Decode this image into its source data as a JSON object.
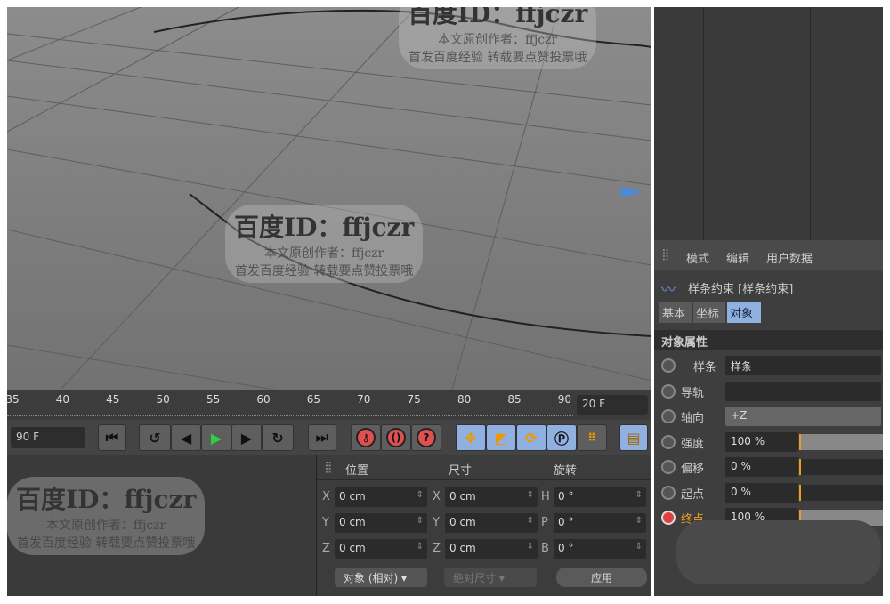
{
  "timeline": {
    "ticks": [
      "35",
      "40",
      "45",
      "50",
      "55",
      "60",
      "65",
      "70",
      "75",
      "80",
      "85",
      "90"
    ],
    "current_frame": "20 F"
  },
  "transport": {
    "end_frame": "90 F"
  },
  "coords": {
    "headers": [
      "位置",
      "尺寸",
      "旋转"
    ],
    "pos": [
      [
        "X",
        "0 cm"
      ],
      [
        "Y",
        "0 cm"
      ],
      [
        "Z",
        "0 cm"
      ]
    ],
    "size": [
      [
        "X",
        "0 cm"
      ],
      [
        "Y",
        "0 cm"
      ],
      [
        "Z",
        "0 cm"
      ]
    ],
    "rot": [
      [
        "H",
        "0 °"
      ],
      [
        "P",
        "0 °"
      ],
      [
        "B",
        "0 °"
      ]
    ],
    "mode_dropdown": "对象 (相对)",
    "size_dropdown": "绝对尺寸",
    "apply": "应用"
  },
  "attributes": {
    "menu": [
      "模式",
      "编辑",
      "用户数据"
    ],
    "title": "样条约束 [样条约束]",
    "tabs": [
      "基本",
      "坐标",
      "对象"
    ],
    "section": "对象属性",
    "rows": [
      {
        "label": "样条",
        "value": "样条"
      },
      {
        "label": "导轨",
        "value": ""
      },
      {
        "label": "轴向",
        "value": "+Z"
      },
      {
        "label": "强度",
        "value": "100 %"
      },
      {
        "label": "偏移",
        "value": "0 %"
      },
      {
        "label": "起点",
        "value": "0 %"
      },
      {
        "label": "终点",
        "value": "100 %"
      }
    ]
  },
  "watermark": {
    "id": "百度ID：ffjczr",
    "line1": "本文原创作者：ffjczr",
    "line2": "首发百度经验 转载要点赞投票哦"
  }
}
